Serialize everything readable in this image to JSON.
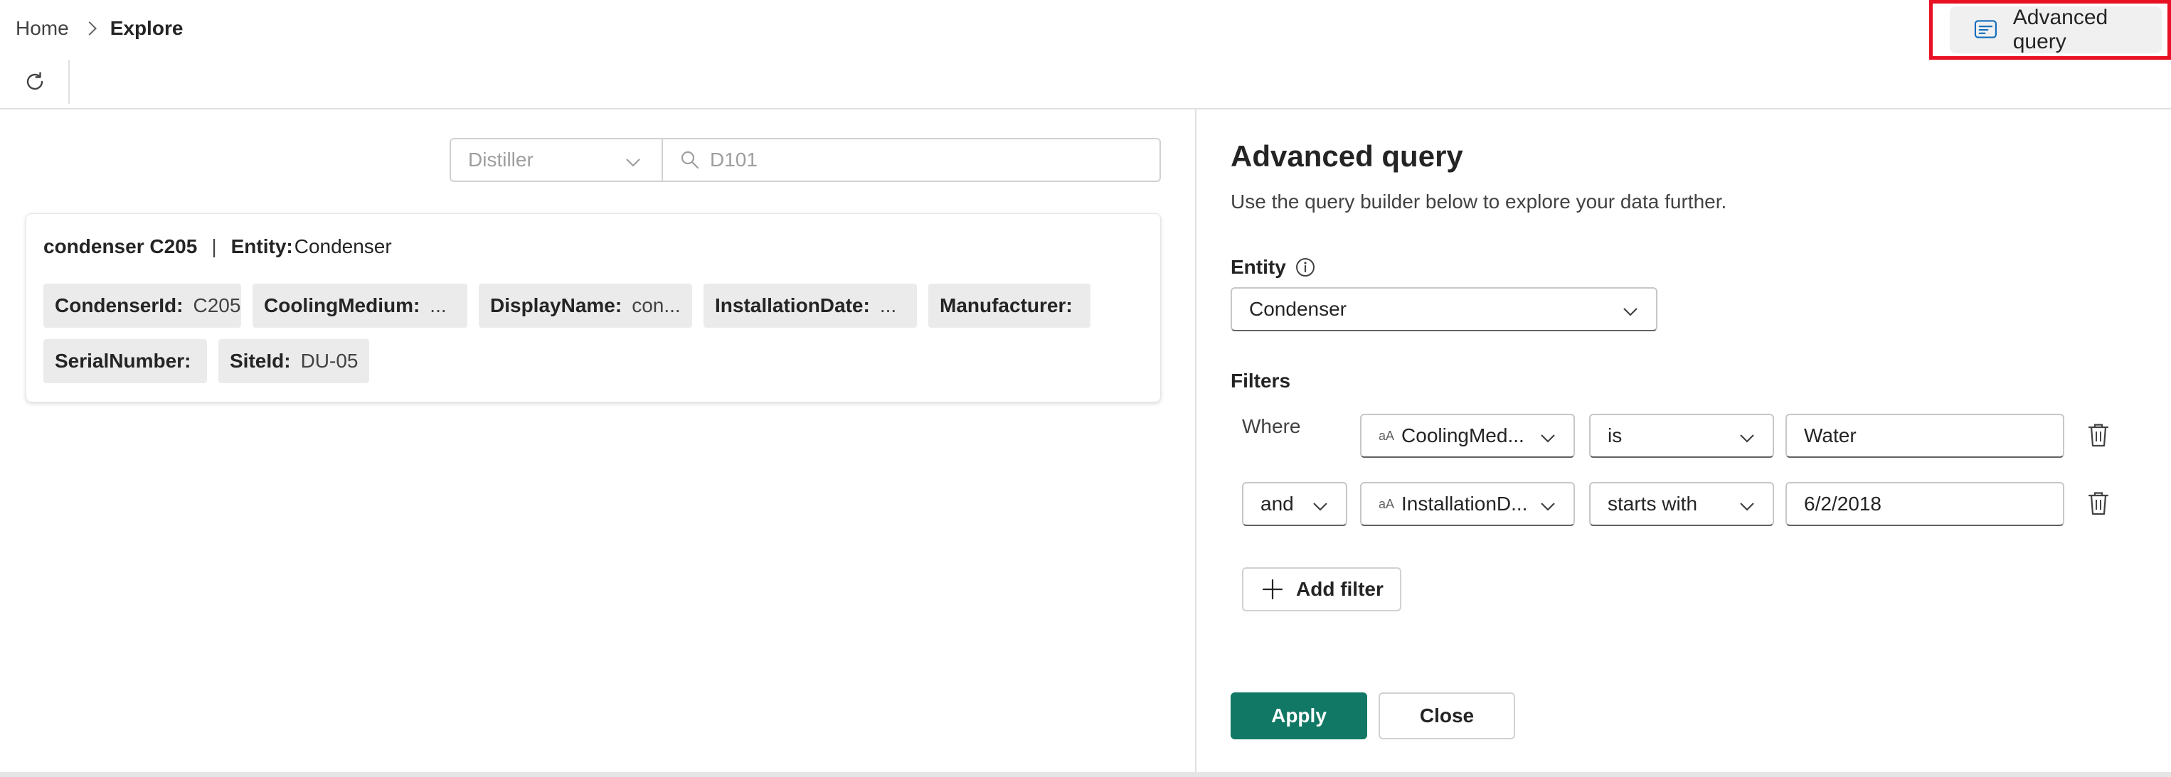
{
  "breadcrumb": {
    "home": "Home",
    "current": "Explore"
  },
  "toolbar": {
    "refresh_icon": "refresh-icon",
    "advanced_query_label": "Advanced query",
    "advanced_query_icon": "query-icon",
    "highlight_color": "#e81123"
  },
  "search": {
    "category_placeholder": "Distiller",
    "query_placeholder": "D101"
  },
  "result_card": {
    "name": "condenser C205",
    "separator": "|",
    "entity_label": "Entity:",
    "entity_value": "Condenser",
    "chips": [
      {
        "key": "CondenserId:",
        "value": "C205"
      },
      {
        "key": "CoolingMedium:",
        "value": "..."
      },
      {
        "key": "DisplayName:",
        "value": "con..."
      },
      {
        "key": "InstallationDate:",
        "value": "..."
      },
      {
        "key": "Manufacturer:",
        "value": ""
      },
      {
        "key": "SerialNumber:",
        "value": ""
      },
      {
        "key": "SiteId:",
        "value": "DU-05"
      }
    ]
  },
  "panel": {
    "title": "Advanced query",
    "description": "Use the query builder below to explore your data further.",
    "entity_label": "Entity",
    "entity_value": "Condenser",
    "filters_label": "Filters",
    "filters": [
      {
        "conjunction": "Where",
        "type_icon": "aA",
        "field": "CoolingMed...",
        "operator": "is",
        "value": "Water"
      },
      {
        "conjunction": "and",
        "type_icon": "aA",
        "field": "InstallationD...",
        "operator": "starts with",
        "value": "6/2/2018"
      }
    ],
    "add_filter_label": "Add filter",
    "apply_label": "Apply",
    "close_label": "Close",
    "accent_color": "#117865"
  }
}
